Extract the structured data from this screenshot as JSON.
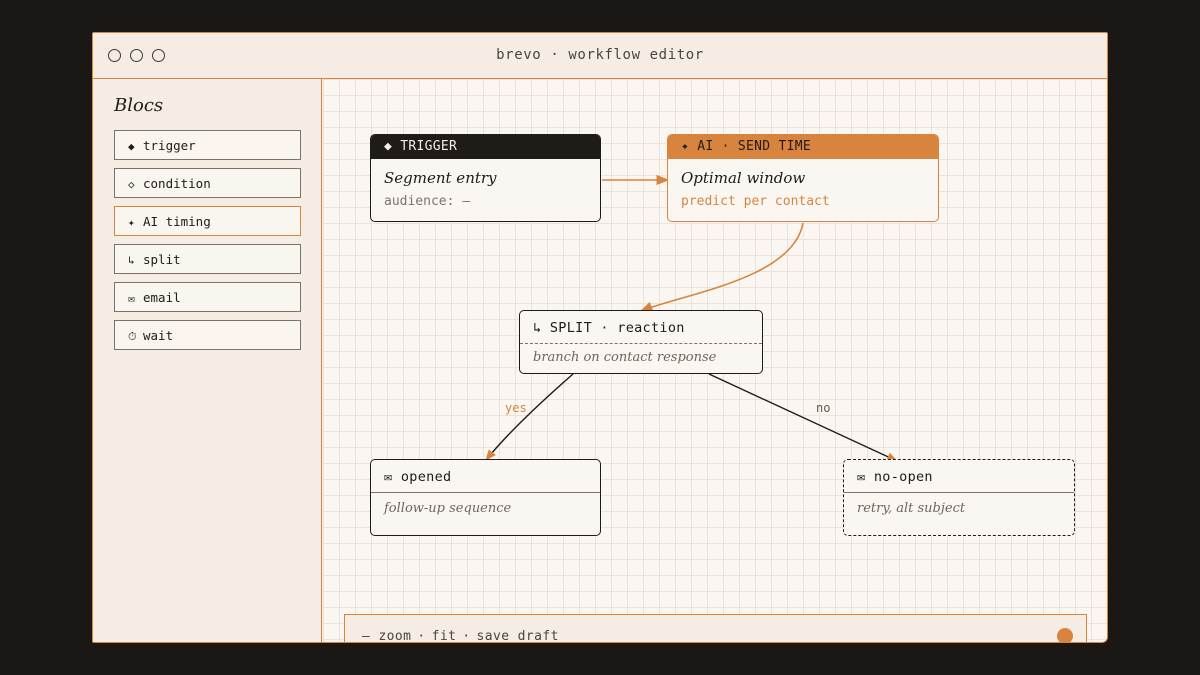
{
  "window": {
    "title": "brevo · workflow editor"
  },
  "sidebar": {
    "heading": "Blocs",
    "items": [
      {
        "icon": "◆",
        "label": "trigger"
      },
      {
        "icon": "◇",
        "label": "condition"
      },
      {
        "icon": "✦",
        "label": "AI timing"
      },
      {
        "icon": "↳",
        "label": "split"
      },
      {
        "icon": "✉",
        "label": "email"
      },
      {
        "icon": "⏱",
        "label": "wait"
      }
    ]
  },
  "nodes": {
    "trigger": {
      "header": "◆ TRIGGER",
      "title": "Segment entry",
      "sub": "audience: —"
    },
    "ai": {
      "header": "✦ AI · SEND TIME",
      "title": "Optimal window",
      "sub": "predict per contact"
    },
    "split": {
      "header": "↳ SPLIT · reaction",
      "desc": "branch on contact response"
    },
    "opened": {
      "header": "✉ opened",
      "desc": "follow-up sequence"
    },
    "noopen": {
      "header": "✉ no-open",
      "desc": "retry, alt subject"
    }
  },
  "edges": {
    "yes": "yes",
    "no": "no"
  },
  "toolbar": {
    "zoom": "— zoom",
    "fit": "fit",
    "save": "save draft",
    "sep": "·"
  },
  "colors": {
    "accent": "#d9843e",
    "ink": "#1f1b18",
    "paper": "#f5ede3",
    "background": "#1a1714"
  }
}
